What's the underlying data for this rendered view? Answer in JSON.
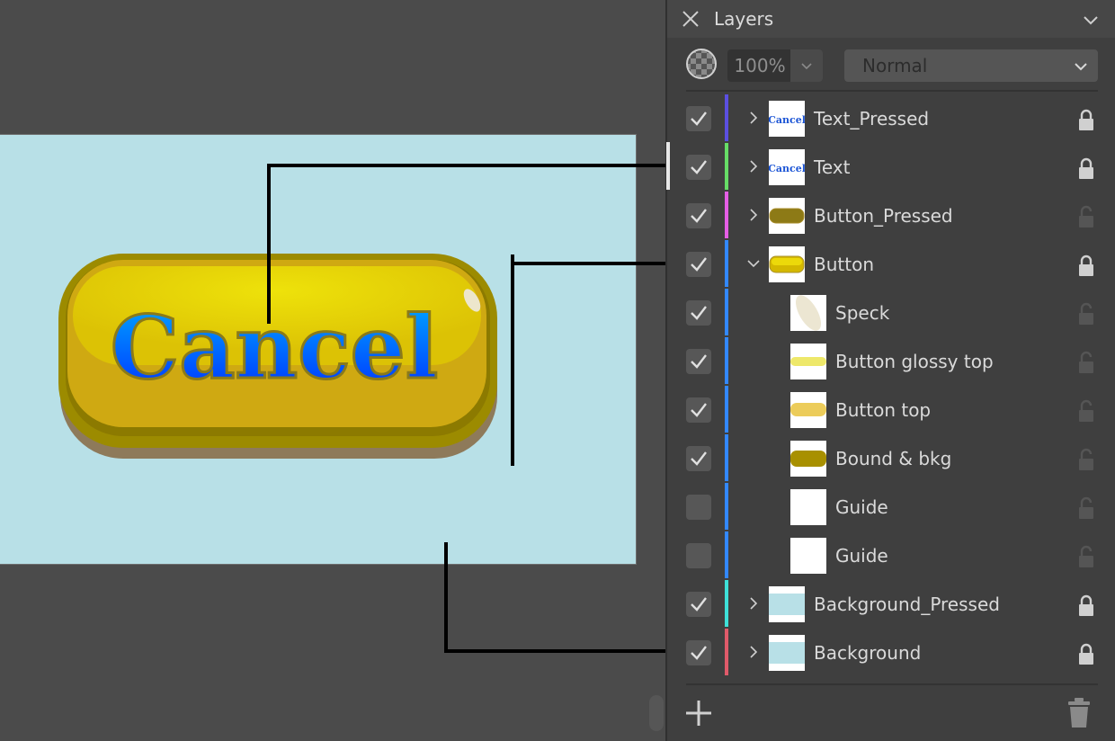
{
  "canvas": {
    "button_text": "Cancel",
    "artboard_color": "#b8e0e7",
    "button_colors": {
      "rim": "#9c8b00",
      "top": "#e6cf06",
      "body": "#d2ab12",
      "shadow": "#8e7a5a",
      "text_top": "#00a8ff",
      "text_bottom": "#0033ff"
    }
  },
  "panel": {
    "title": "Layers",
    "opacity": "100%",
    "blend_mode": "Normal"
  },
  "layers": [
    {
      "name": "Text_Pressed",
      "visible": true,
      "locked": true,
      "expanded": false,
      "child": false,
      "tag_color": "#5b4fe0",
      "thumb": "text"
    },
    {
      "name": "Text",
      "visible": true,
      "locked": true,
      "expanded": false,
      "child": false,
      "tag_color": "#66dd66",
      "thumb": "text"
    },
    {
      "name": "Button_Pressed",
      "visible": true,
      "locked": false,
      "expanded": false,
      "child": false,
      "tag_color": "#e55ee5",
      "thumb": "button-pressed"
    },
    {
      "name": "Button",
      "visible": true,
      "locked": true,
      "expanded": true,
      "child": false,
      "tag_color": "#3388ff",
      "thumb": "button"
    },
    {
      "name": "Speck",
      "visible": true,
      "locked": false,
      "child": true,
      "tag_color": "#3388ff",
      "thumb": "speck"
    },
    {
      "name": "Button glossy top",
      "visible": true,
      "locked": false,
      "child": true,
      "tag_color": "#3388ff",
      "thumb": "glossy"
    },
    {
      "name": "Button top",
      "visible": true,
      "locked": false,
      "child": true,
      "tag_color": "#3388ff",
      "thumb": "top"
    },
    {
      "name": "Bound & bkg",
      "visible": true,
      "locked": false,
      "child": true,
      "tag_color": "#3388ff",
      "thumb": "bkg"
    },
    {
      "name": "Guide",
      "visible": false,
      "locked": false,
      "child": true,
      "tag_color": "#3388ff",
      "thumb": "blank"
    },
    {
      "name": "Guide",
      "visible": false,
      "locked": false,
      "child": true,
      "tag_color": "#3388ff",
      "thumb": "blank"
    },
    {
      "name": "Background_Pressed",
      "visible": true,
      "locked": true,
      "expanded": false,
      "child": false,
      "tag_color": "#3ee0d8",
      "thumb": "bg"
    },
    {
      "name": "Background",
      "visible": true,
      "locked": true,
      "expanded": false,
      "child": false,
      "tag_color": "#e05a6a",
      "thumb": "bg"
    }
  ],
  "thumb_text": "Cancel"
}
